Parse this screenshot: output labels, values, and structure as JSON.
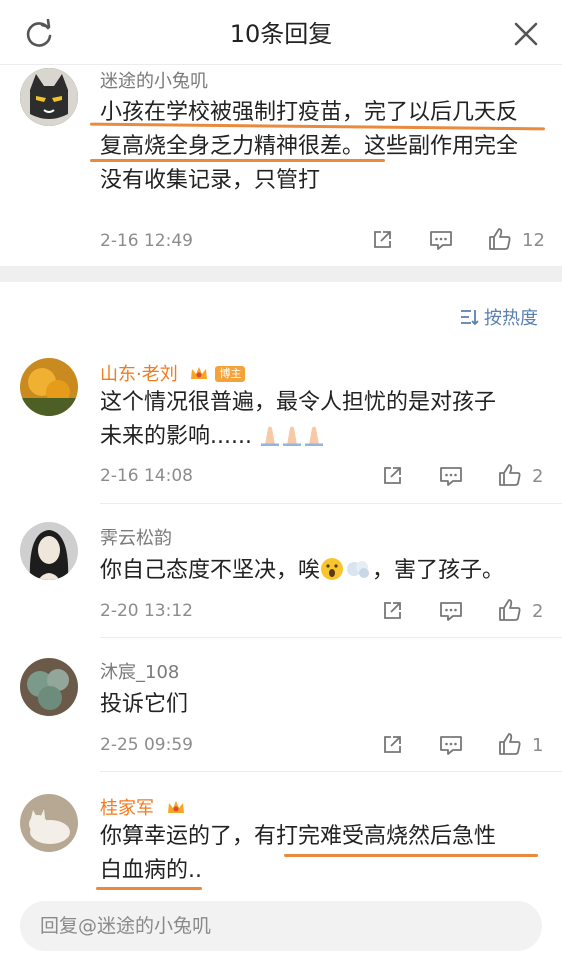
{
  "header": {
    "title": "10条回复"
  },
  "top_comment": {
    "username": "迷途的小兔叽",
    "text_line1": "小孩在学校被强制打疫苗，完了以后几天反",
    "text_line2a": "复高烧全身乏力精神很差",
    "text_line2b": "。这些副作用完全",
    "text_line3": "没有收集记录，只管打",
    "time": "2-16 12:49",
    "likes": "12"
  },
  "sort": {
    "label": "按热度"
  },
  "replies": [
    {
      "username": "山东·老刘",
      "badge": "博主",
      "text_line1": "这个情况很普遍，最令人担忧的是对孩子",
      "text_line2": "未来的影响......",
      "time": "2-16 14:08",
      "likes": "2"
    },
    {
      "username": "霁云松韵",
      "text_a": "你自己态度不坚决，唉",
      "text_b": "，害了孩子。",
      "time": "2-20 13:12",
      "likes": "2"
    },
    {
      "username": "沐宸_108",
      "text": "投诉它们",
      "time": "2-25 09:59",
      "likes": "1"
    },
    {
      "username": "桂家军",
      "text_line1a": "你算幸运的了，",
      "text_line1b": "有打完难受高烧然后急性",
      "text_line2": "白血病的.."
    }
  ],
  "reply_input": {
    "placeholder": "回复@迷途的小兔叽"
  },
  "colors": {
    "accent_orange": "#f37a1f",
    "underline": "#e98a3e",
    "link_blue": "#5a7fb0"
  },
  "icons": [
    "refresh-icon",
    "close-icon",
    "share-icon",
    "comment-icon",
    "like-icon",
    "sort-icon",
    "crown-icon",
    "pray-emoji",
    "surprised-emoji",
    "puff-emoji"
  ]
}
